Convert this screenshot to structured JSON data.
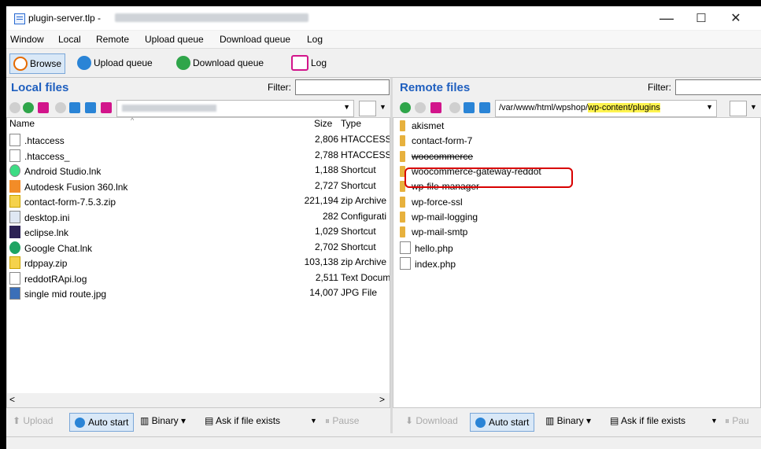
{
  "window": {
    "title": "plugin-server.tlp - ",
    "minimize": "—",
    "maximize": "☐",
    "close": "✕"
  },
  "menu": [
    "Window",
    "Local",
    "Remote",
    "Upload queue",
    "Download queue",
    "Log"
  ],
  "toolbar": {
    "browse": "Browse",
    "upload_queue": "Upload queue",
    "download_queue": "Download queue",
    "log": "Log"
  },
  "local": {
    "title": "Local files",
    "filter_label": "Filter:",
    "columns": {
      "name": "Name",
      "size": "Size",
      "type": "Type"
    },
    "files": [
      {
        "name": ".htaccess",
        "size": "2,806",
        "type": "HTACCESS",
        "icon": "file-icon"
      },
      {
        "name": ".htaccess_",
        "size": "2,788",
        "type": "HTACCESS",
        "icon": "file-icon"
      },
      {
        "name": "Android Studio.lnk",
        "size": "1,188",
        "type": "Shortcut",
        "icon": "android-studio-icon"
      },
      {
        "name": "Autodesk Fusion 360.lnk",
        "size": "2,727",
        "type": "Shortcut",
        "icon": "fusion-icon"
      },
      {
        "name": "contact-form-7.5.3.zip",
        "size": "221,194",
        "type": "zip Archive",
        "icon": "zip-icon"
      },
      {
        "name": "desktop.ini",
        "size": "282",
        "type": "Configurati",
        "icon": "ini-icon"
      },
      {
        "name": "eclipse.lnk",
        "size": "1,029",
        "type": "Shortcut",
        "icon": "eclipse-icon"
      },
      {
        "name": "Google Chat.lnk",
        "size": "2,702",
        "type": "Shortcut",
        "icon": "google-chat-icon"
      },
      {
        "name": "rdppay.zip",
        "size": "103,138",
        "type": "zip Archive",
        "icon": "zip-icon"
      },
      {
        "name": "reddotRApi.log",
        "size": "2,511",
        "type": "Text Docum",
        "icon": "text-file-icon"
      },
      {
        "name": "single mid route.jpg",
        "size": "14,007",
        "type": "JPG File",
        "icon": "image-file-icon"
      }
    ],
    "bottom": {
      "upload": "Upload",
      "auto_start": "Auto start",
      "binary": "Binary",
      "ask": "Ask if file exists",
      "pause": "Pause"
    }
  },
  "remote": {
    "title": "Remote files",
    "filter_label": "Filter:",
    "path_prefix": "/var/www/html/wpshop/",
    "path_highlight": "wp-content/plugins",
    "items": [
      {
        "name": "akismet",
        "kind": "folder"
      },
      {
        "name": "contact-form-7",
        "kind": "folder"
      },
      {
        "name": "woocommerce",
        "kind": "folder"
      },
      {
        "name": "woocommerce-gateway-reddot",
        "kind": "folder"
      },
      {
        "name": "wp-file-manager",
        "kind": "folder"
      },
      {
        "name": "wp-force-ssl",
        "kind": "folder"
      },
      {
        "name": "wp-mail-logging",
        "kind": "folder"
      },
      {
        "name": "wp-mail-smtp",
        "kind": "folder"
      },
      {
        "name": "hello.php",
        "kind": "file"
      },
      {
        "name": "index.php",
        "kind": "file"
      }
    ],
    "bottom": {
      "download": "Download",
      "auto_start": "Auto start",
      "binary": "Binary",
      "ask": "Ask if file exists",
      "pause": "Pau"
    }
  },
  "colors": {
    "title_blue": "#1f5fbf",
    "highlight": "#fff44f",
    "annotation_red": "#d80000",
    "folder": "#e7b13d"
  }
}
